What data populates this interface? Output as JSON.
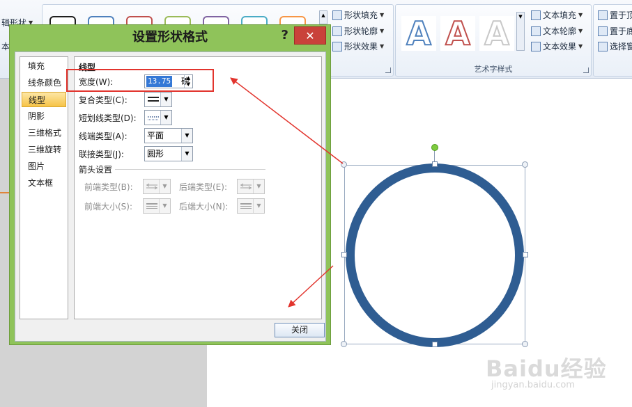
{
  "ribbon": {
    "edit_shape_label": "辑形状",
    "left_fragment": "本",
    "shape_styles": {
      "swatch_colors": [
        "#1f1f1f",
        "#4f81bd",
        "#c0504d",
        "#9bbb59",
        "#8064a2",
        "#4bacc6",
        "#f79646"
      ],
      "fill_label": "形状填充",
      "outline_label": "形状轮廓",
      "effects_label": "形状效果"
    },
    "wordart": {
      "letters": [
        "A",
        "A",
        "A"
      ],
      "group_label": "艺术字样式",
      "fill_label": "文本填充",
      "outline_label": "文本轮廓",
      "effects_label": "文本效果"
    },
    "arrange": {
      "bring_front_label": "置于顶",
      "send_back_label": "置于底",
      "selection_label": "选择窗"
    }
  },
  "dialog": {
    "title": "设置形状格式",
    "help_label": "?",
    "close_label": "✕",
    "nav": [
      {
        "label": "填充"
      },
      {
        "label": "线条颜色"
      },
      {
        "label": "线型",
        "selected": true
      },
      {
        "label": "阴影"
      },
      {
        "label": "三维格式"
      },
      {
        "label": "三维旋转"
      },
      {
        "label": "图片"
      },
      {
        "label": "文本框"
      }
    ],
    "panel": {
      "heading": "线型",
      "width_label": "宽度(W):",
      "width_value": "13.75",
      "width_unit": "磅",
      "compound_label": "复合类型(C):",
      "dash_label": "短划线类型(D):",
      "cap_label": "线端类型(A):",
      "cap_value": "平面",
      "join_label": "联接类型(J):",
      "join_value": "圆形",
      "arrow_heading": "箭头设置",
      "begin_type_label": "前端类型(B):",
      "end_type_label": "后端类型(E):",
      "begin_size_label": "前端大小(S):",
      "end_size_label": "后端大小(N):"
    },
    "close_button": "关闭"
  },
  "watermark": {
    "logo": "Baidu经验",
    "url": "jingyan.baidu.com"
  },
  "colors": {
    "dialog_frame": "#8fc35a",
    "ring": "#2f5d92",
    "annotation": "#e2342d",
    "selected_nav": "#f6c347"
  }
}
